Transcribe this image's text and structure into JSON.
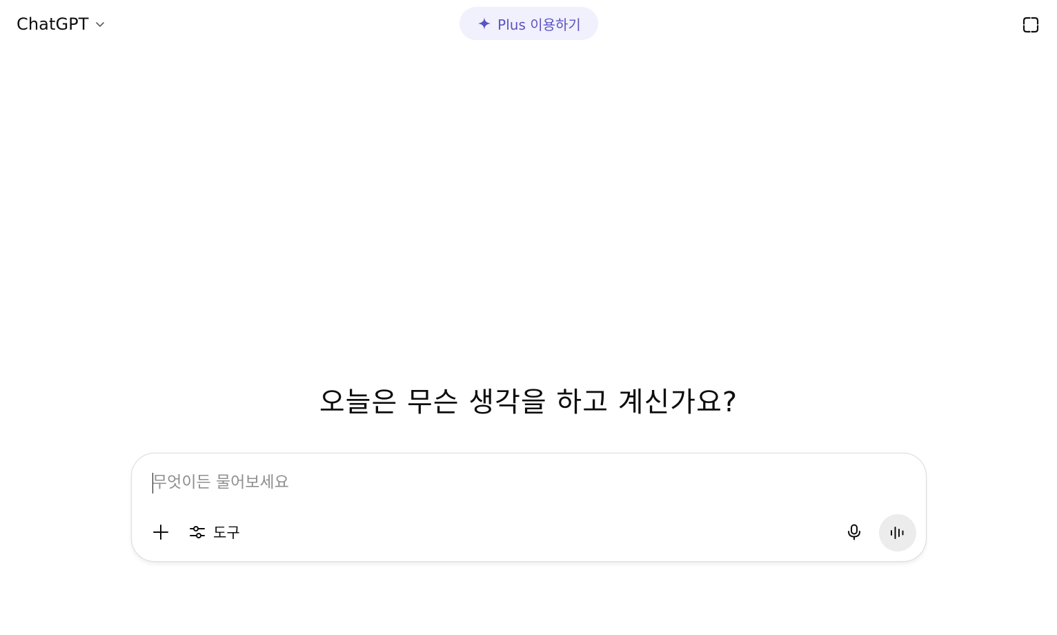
{
  "header": {
    "model_label": "ChatGPT",
    "model_chevron_icon": "chevron-down-icon",
    "upgrade_pill": {
      "icon": "sparkle-icon",
      "label": "Plus 이용하기",
      "accent_color": "#5a53c2",
      "background_color": "#f1f0fd"
    },
    "temporary_chat_icon": "temporary-chat-icon"
  },
  "main": {
    "greeting": "오늘은 무슨 생각을 하고 계신가요?"
  },
  "composer": {
    "input_value": "",
    "placeholder": "무엇이든 물어보세요",
    "add_icon": "plus-icon",
    "tools_icon": "sliders-icon",
    "tools_label": "도구",
    "mic_icon": "microphone-icon",
    "voice_icon": "voice-waveform-icon"
  }
}
